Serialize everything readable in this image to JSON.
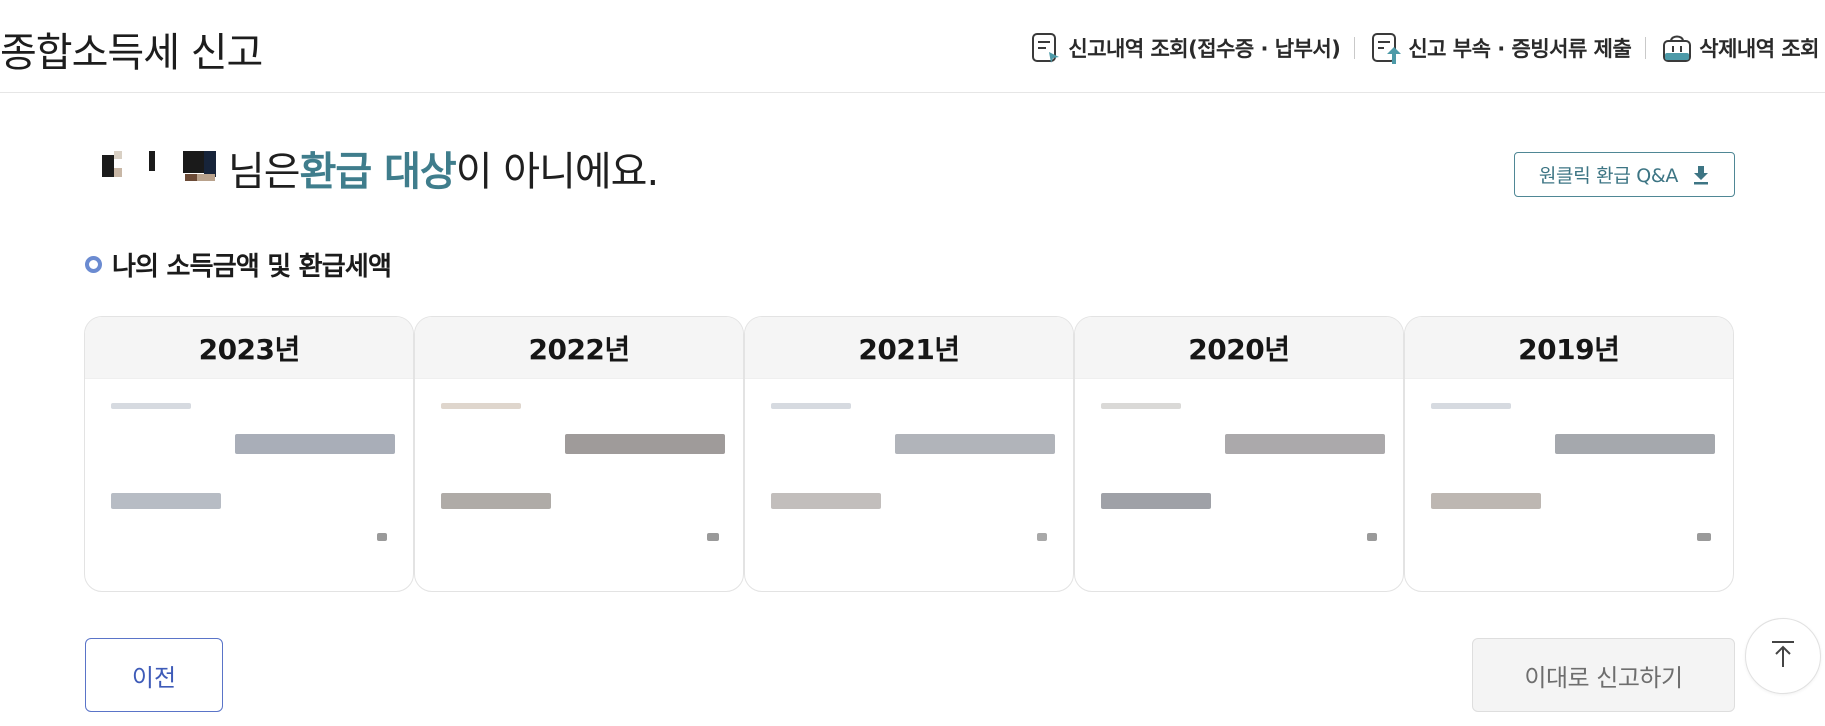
{
  "header": {
    "title": "종합소득세 신고",
    "links": [
      {
        "label": "신고내역 조회(접수증 · 납부서)",
        "icon": "document-view-icon"
      },
      {
        "label": "신고 부속 · 증빙서류 제출",
        "icon": "document-upload-icon"
      },
      {
        "label": "삭제내역 조회",
        "icon": "trash-basket-icon"
      }
    ]
  },
  "result": {
    "suffix_before": "님은 ",
    "accent": "환급 대상",
    "suffix_after": "이 아니에요."
  },
  "qa_button": {
    "label": "원클릭 환급 Q&A",
    "icon": "download-icon"
  },
  "section": {
    "title": "나의 소득금액 및 환급세액"
  },
  "years": [
    {
      "label": "2023년"
    },
    {
      "label": "2022년"
    },
    {
      "label": "2021년"
    },
    {
      "label": "2020년"
    },
    {
      "label": "2019년"
    }
  ],
  "buttons": {
    "prev": "이전",
    "submit": "이대로 신고하기",
    "top_icon": "arrow-up-to-top-icon"
  },
  "colors": {
    "accent": "#3f7d8c",
    "prev_border": "#5a74c8",
    "bullet": "#6b8bd1"
  }
}
